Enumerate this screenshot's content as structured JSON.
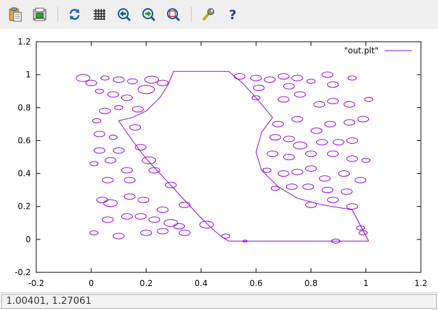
{
  "toolbar": {
    "buttons": [
      {
        "icon": "clipboard-copy-icon",
        "label": "Copy to clipboard"
      },
      {
        "icon": "print-icon",
        "label": "Print"
      },
      {
        "icon": "replot-icon",
        "label": "Replot"
      },
      {
        "icon": "grid-icon",
        "label": "Toggle grid"
      },
      {
        "icon": "zoom-previous-icon",
        "label": "Previous zoom"
      },
      {
        "icon": "zoom-next-icon",
        "label": "Next zoom"
      },
      {
        "icon": "autoscale-icon",
        "label": "Autoscale"
      },
      {
        "icon": "settings-wrench-icon",
        "label": "Settings"
      },
      {
        "icon": "help-icon",
        "label": "Help"
      }
    ]
  },
  "colors": {
    "series": "#9400d3",
    "axis": "#000000",
    "toolbar_bg": "#efefef",
    "plot_bg": "#ffffff"
  },
  "chart_data": {
    "type": "line",
    "title": "",
    "xlabel": "",
    "ylabel": "",
    "xlim": [
      -0.2,
      1.2
    ],
    "ylim": [
      -0.2,
      1.2
    ],
    "xticks": [
      -0.2,
      0,
      0.2,
      0.4,
      0.6,
      0.8,
      1,
      1.2
    ],
    "xtick_labels": [
      "-0.2",
      "0",
      "0.2",
      "0.4",
      "0.6",
      "0.8",
      "1",
      "1.2"
    ],
    "yticks": [
      -0.2,
      0,
      0.2,
      0.4,
      0.6,
      0.8,
      1,
      1.2
    ],
    "ytick_labels": [
      "-0.2",
      "0",
      "0.2",
      "0.4",
      "0.6",
      "0.8",
      "1",
      "1.2"
    ],
    "grid": false,
    "legend_position": "top-right",
    "series": [
      {
        "name": "\"out.plt\"",
        "outline": [
          [
            0.5,
            -0.01
          ],
          [
            0.48,
            0.01
          ],
          [
            0.45,
            0.05
          ],
          [
            0.4,
            0.13
          ],
          [
            0.35,
            0.22
          ],
          [
            0.3,
            0.31
          ],
          [
            0.25,
            0.4
          ],
          [
            0.2,
            0.49
          ],
          [
            0.15,
            0.6
          ],
          [
            0.1,
            0.72
          ],
          [
            0.15,
            0.74
          ],
          [
            0.2,
            0.78
          ],
          [
            0.25,
            0.86
          ],
          [
            0.28,
            0.94
          ],
          [
            0.3,
            1.02
          ],
          [
            0.5,
            1.02
          ],
          [
            0.55,
            0.95
          ],
          [
            0.6,
            0.86
          ],
          [
            0.66,
            0.74
          ],
          [
            0.62,
            0.65
          ],
          [
            0.6,
            0.53
          ],
          [
            0.62,
            0.42
          ],
          [
            0.68,
            0.32
          ],
          [
            0.75,
            0.25
          ],
          [
            0.84,
            0.21
          ],
          [
            0.95,
            0.18
          ],
          [
            1.01,
            -0.01
          ],
          [
            0.5,
            -0.01
          ]
        ],
        "bubbles": [
          [
            -0.03,
            0.98,
            0.025
          ],
          [
            0.0,
            0.95,
            0.02
          ],
          [
            0.05,
            0.98,
            0.015
          ],
          [
            0.1,
            0.97,
            0.02
          ],
          [
            0.15,
            0.96,
            0.018
          ],
          [
            0.22,
            0.97,
            0.025
          ],
          [
            0.26,
            0.95,
            0.02
          ],
          [
            0.03,
            0.9,
            0.015
          ],
          [
            0.08,
            0.88,
            0.02
          ],
          [
            0.2,
            0.91,
            0.03
          ],
          [
            0.13,
            0.86,
            0.02
          ],
          [
            0.05,
            0.78,
            0.02
          ],
          [
            0.1,
            0.8,
            0.015
          ],
          [
            0.17,
            0.79,
            0.02
          ],
          [
            0.02,
            0.72,
            0.015
          ],
          [
            0.03,
            0.64,
            0.02
          ],
          [
            0.08,
            0.62,
            0.015
          ],
          [
            0.16,
            0.68,
            0.02
          ],
          [
            0.03,
            0.54,
            0.02
          ],
          [
            0.1,
            0.54,
            0.02
          ],
          [
            0.18,
            0.56,
            0.02
          ],
          [
            0.01,
            0.46,
            0.015
          ],
          [
            0.07,
            0.48,
            0.02
          ],
          [
            0.13,
            0.42,
            0.02
          ],
          [
            0.21,
            0.48,
            0.025
          ],
          [
            0.06,
            0.36,
            0.02
          ],
          [
            0.14,
            0.36,
            0.02
          ],
          [
            0.23,
            0.42,
            0.02
          ],
          [
            0.04,
            0.24,
            0.02
          ],
          [
            0.07,
            0.22,
            0.025
          ],
          [
            0.14,
            0.26,
            0.02
          ],
          [
            0.19,
            0.24,
            0.02
          ],
          [
            0.06,
            0.12,
            0.02
          ],
          [
            0.13,
            0.14,
            0.02
          ],
          [
            0.18,
            0.14,
            0.02
          ],
          [
            0.23,
            0.12,
            0.02
          ],
          [
            0.01,
            0.04,
            0.015
          ],
          [
            0.1,
            0.02,
            0.02
          ],
          [
            0.2,
            0.04,
            0.02
          ],
          [
            0.26,
            0.05,
            0.02
          ],
          [
            0.29,
            0.1,
            0.025
          ],
          [
            0.32,
            0.08,
            0.02
          ],
          [
            0.26,
            0.18,
            0.02
          ],
          [
            0.29,
            0.33,
            0.02
          ],
          [
            0.42,
            0.09,
            0.025
          ],
          [
            0.34,
            0.04,
            0.02
          ],
          [
            0.34,
            0.21,
            0.02
          ],
          [
            0.49,
            0.02,
            0.015
          ],
          [
            0.54,
            0.99,
            0.02
          ],
          [
            0.6,
            0.98,
            0.02
          ],
          [
            0.61,
            0.92,
            0.02
          ],
          [
            0.6,
            0.86,
            0.015
          ],
          [
            0.65,
            0.97,
            0.02
          ],
          [
            0.7,
            0.99,
            0.02
          ],
          [
            0.72,
            0.93,
            0.02
          ],
          [
            0.75,
            0.98,
            0.02
          ],
          [
            0.8,
            0.96,
            0.015
          ],
          [
            0.86,
            1.0,
            0.02
          ],
          [
            0.88,
            0.94,
            0.02
          ],
          [
            0.95,
            0.98,
            0.015
          ],
          [
            0.7,
            0.85,
            0.02
          ],
          [
            0.76,
            0.88,
            0.02
          ],
          [
            0.83,
            0.82,
            0.02
          ],
          [
            0.88,
            0.84,
            0.02
          ],
          [
            0.94,
            0.82,
            0.02
          ],
          [
            1.01,
            0.85,
            0.015
          ],
          [
            0.68,
            0.7,
            0.02
          ],
          [
            0.75,
            0.73,
            0.02
          ],
          [
            0.82,
            0.66,
            0.02
          ],
          [
            0.87,
            0.7,
            0.02
          ],
          [
            0.94,
            0.71,
            0.02
          ],
          [
            0.99,
            0.73,
            0.02
          ],
          [
            0.67,
            0.62,
            0.02
          ],
          [
            0.72,
            0.61,
            0.02
          ],
          [
            0.76,
            0.57,
            0.025
          ],
          [
            0.84,
            0.59,
            0.02
          ],
          [
            0.9,
            0.59,
            0.02
          ],
          [
            0.95,
            0.6,
            0.02
          ],
          [
            0.66,
            0.52,
            0.02
          ],
          [
            0.72,
            0.5,
            0.02
          ],
          [
            0.8,
            0.52,
            0.02
          ],
          [
            0.88,
            0.52,
            0.02
          ],
          [
            0.95,
            0.49,
            0.02
          ],
          [
            1.0,
            0.48,
            0.015
          ],
          [
            0.64,
            0.42,
            0.015
          ],
          [
            0.7,
            0.4,
            0.02
          ],
          [
            0.75,
            0.41,
            0.02
          ],
          [
            0.8,
            0.43,
            0.02
          ],
          [
            0.85,
            0.37,
            0.02
          ],
          [
            0.92,
            0.4,
            0.02
          ],
          [
            0.98,
            0.36,
            0.02
          ],
          [
            0.67,
            0.31,
            0.015
          ],
          [
            0.73,
            0.32,
            0.02
          ],
          [
            0.79,
            0.32,
            0.02
          ],
          [
            0.86,
            0.3,
            0.02
          ],
          [
            0.93,
            0.29,
            0.02
          ],
          [
            0.8,
            0.21,
            0.02
          ],
          [
            0.88,
            0.24,
            0.02
          ],
          [
            0.95,
            0.2,
            0.02
          ],
          [
            0.98,
            0.07,
            0.015
          ],
          [
            0.99,
            0.04,
            0.015
          ],
          [
            0.89,
            -0.01,
            0.015
          ],
          [
            0.56,
            -0.01,
            0.008
          ]
        ]
      }
    ]
  },
  "status": {
    "coordinates": "1.00401,  1.27061"
  }
}
